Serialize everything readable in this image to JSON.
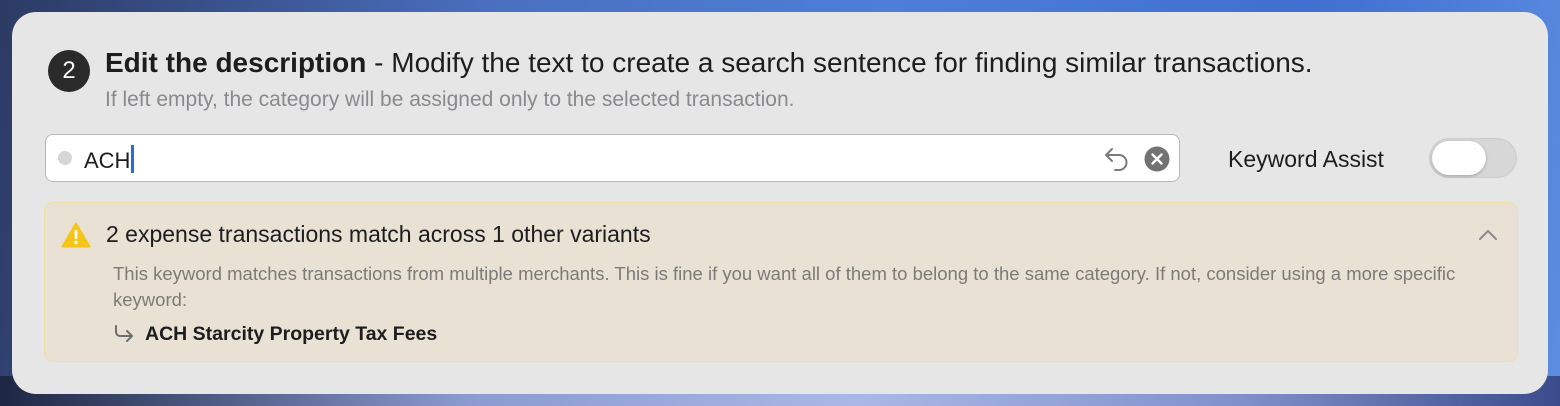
{
  "step": {
    "number": "2",
    "title": "Edit the description",
    "separator": " - ",
    "description": "Modify the text to create a search sentence for finding similar transactions.",
    "subtitle": "If left empty, the category will be assigned only to the selected transaction."
  },
  "search_field": {
    "value": "ACH",
    "undo_icon": "undo-arrow-icon",
    "clear_icon": "clear-circle-x-icon"
  },
  "keyword_assist": {
    "label": "Keyword Assist",
    "enabled": false
  },
  "warning": {
    "icon": "warning-triangle-icon",
    "title": "2 expense transactions match across 1 other variants",
    "message": "This keyword matches transactions from multiple merchants. This is fine if you want all of them to belong to the same category. If not, consider using a more specific keyword:",
    "suggestions": [
      {
        "icon": "return-arrow-icon",
        "keyword": "ACH Starcity Property Tax Fees"
      }
    ],
    "collapse_icon": "chevron-up-icon"
  },
  "colors": {
    "panel_bg": "#e6e6e6",
    "warning_bg": "#e8e1d4",
    "warning_border": "#ece0a8",
    "warning_icon": "#f5c518",
    "caret": "#1f6fe0"
  }
}
